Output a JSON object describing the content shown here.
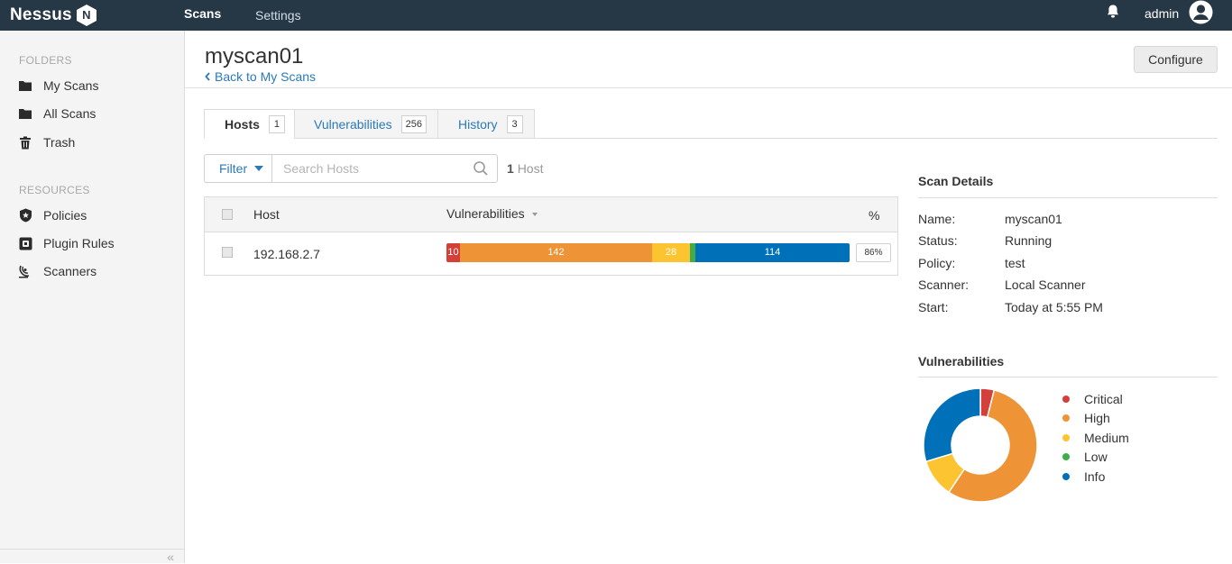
{
  "app": {
    "brand": "Nessus",
    "brand_badge": "N"
  },
  "topnav": {
    "scans": "Scans",
    "settings": "Settings",
    "user": "admin"
  },
  "sidebar": {
    "folders_heading": "FOLDERS",
    "folders": [
      {
        "label": "My Scans",
        "icon": "folder-icon"
      },
      {
        "label": "All Scans",
        "icon": "folder-icon"
      },
      {
        "label": "Trash",
        "icon": "trash-icon"
      }
    ],
    "resources_heading": "RESOURCES",
    "resources": [
      {
        "label": "Policies",
        "icon": "shield-icon"
      },
      {
        "label": "Plugin Rules",
        "icon": "plugin-icon"
      },
      {
        "label": "Scanners",
        "icon": "scanner-icon"
      }
    ],
    "collapse_glyph": "«"
  },
  "scan": {
    "title": "myscan01",
    "back_label": "Back to My Scans",
    "configure_label": "Configure"
  },
  "tabs": [
    {
      "label": "Hosts",
      "count": "1",
      "active": true
    },
    {
      "label": "Vulnerabilities",
      "count": "256",
      "active": false
    },
    {
      "label": "History",
      "count": "3",
      "active": false
    }
  ],
  "filter": {
    "label": "Filter",
    "search_placeholder": "Search Hosts",
    "count": "1",
    "count_label": "Host"
  },
  "table": {
    "columns": {
      "host": "Host",
      "vulnerabilities": "Vulnerabilities",
      "percent": "%"
    },
    "rows": [
      {
        "host": "192.168.2.7",
        "percent": "86%",
        "segments": [
          {
            "severity": "Critical",
            "value": 10,
            "label": "10",
            "color": "#d43f3a"
          },
          {
            "severity": "High",
            "value": 142,
            "label": "142",
            "color": "#ee9336"
          },
          {
            "severity": "Medium",
            "value": 28,
            "label": "28",
            "color": "#fdc431"
          },
          {
            "severity": "Low",
            "value": 4,
            "label": "",
            "color": "#3fae49"
          },
          {
            "severity": "Info",
            "value": 114,
            "label": "114",
            "color": "#0071b9"
          }
        ]
      }
    ]
  },
  "details": {
    "heading": "Scan Details",
    "items": [
      {
        "key": "Name:",
        "value": "myscan01"
      },
      {
        "key": "Status:",
        "value": "Running"
      },
      {
        "key": "Policy:",
        "value": "test"
      },
      {
        "key": "Scanner:",
        "value": "Local Scanner"
      },
      {
        "key": "Start:",
        "value": "Today at 5:55 PM"
      }
    ]
  },
  "vuln_chart": {
    "heading": "Vulnerabilities",
    "legend": [
      {
        "label": "Critical",
        "color": "#d43f3a"
      },
      {
        "label": "High",
        "color": "#ee9336"
      },
      {
        "label": "Medium",
        "color": "#fdc431"
      },
      {
        "label": "Low",
        "color": "#3fae49"
      },
      {
        "label": "Info",
        "color": "#0071b9"
      }
    ]
  },
  "chart_data": {
    "type": "pie",
    "title": "Vulnerabilities",
    "categories": [
      "Critical",
      "High",
      "Medium",
      "Low",
      "Info"
    ],
    "values": [
      10,
      142,
      28,
      0,
      76
    ],
    "colors": [
      "#d43f3a",
      "#ee9336",
      "#fdc431",
      "#3fae49",
      "#0071b9"
    ],
    "legend": "right"
  }
}
